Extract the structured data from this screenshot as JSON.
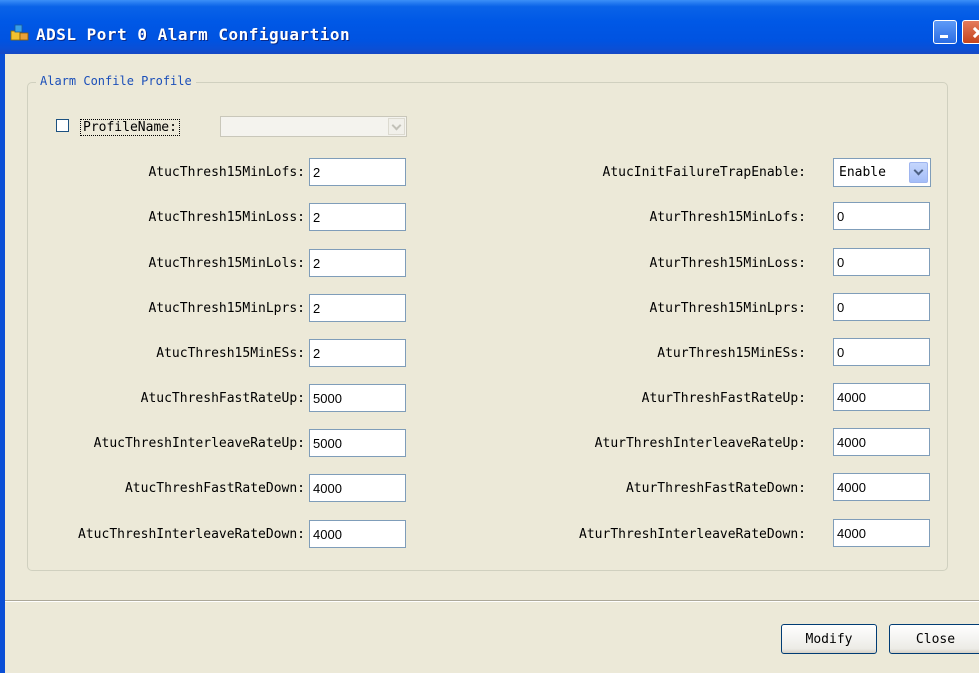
{
  "window": {
    "title": "ADSL Port 0 Alarm Configuartion",
    "titlebar_color": "#0054e3",
    "body_color": "#ece9d8"
  },
  "group": {
    "title": "Alarm Confile Profile",
    "profile_name_label": "ProfileName:",
    "profile_name_checked": false,
    "profile_name_value": ""
  },
  "left_fields": [
    {
      "label": "AtucThresh15MinLofs:",
      "value": "2"
    },
    {
      "label": "AtucThresh15MinLoss:",
      "value": "2"
    },
    {
      "label": "AtucThresh15MinLols:",
      "value": "2"
    },
    {
      "label": "AtucThresh15MinLprs:",
      "value": "2"
    },
    {
      "label": "AtucThresh15MinESs:",
      "value": "2"
    },
    {
      "label": "AtucThreshFastRateUp:",
      "value": "5000"
    },
    {
      "label": "AtucThreshInterleaveRateUp:",
      "value": "5000"
    },
    {
      "label": "AtucThreshFastRateDown:",
      "value": "4000"
    },
    {
      "label": "AtucThreshInterleaveRateDown:",
      "value": "4000"
    }
  ],
  "trap": {
    "label": "AtucInitFailureTrapEnable:",
    "value": "Enable"
  },
  "right_fields": [
    {
      "label": "AturThresh15MinLofs:",
      "value": "0"
    },
    {
      "label": "AturThresh15MinLoss:",
      "value": "0"
    },
    {
      "label": "AturThresh15MinLprs:",
      "value": "0"
    },
    {
      "label": "AturThresh15MinESs:",
      "value": "0"
    },
    {
      "label": "AturThreshFastRateUp:",
      "value": "4000"
    },
    {
      "label": "AturThreshInterleaveRateUp:",
      "value": "4000"
    },
    {
      "label": "AturThreshFastRateDown:",
      "value": "4000"
    },
    {
      "label": "AturThreshInterleaveRateDown:",
      "value": "4000"
    }
  ],
  "buttons": {
    "modify": "Modify",
    "close": "Close"
  }
}
